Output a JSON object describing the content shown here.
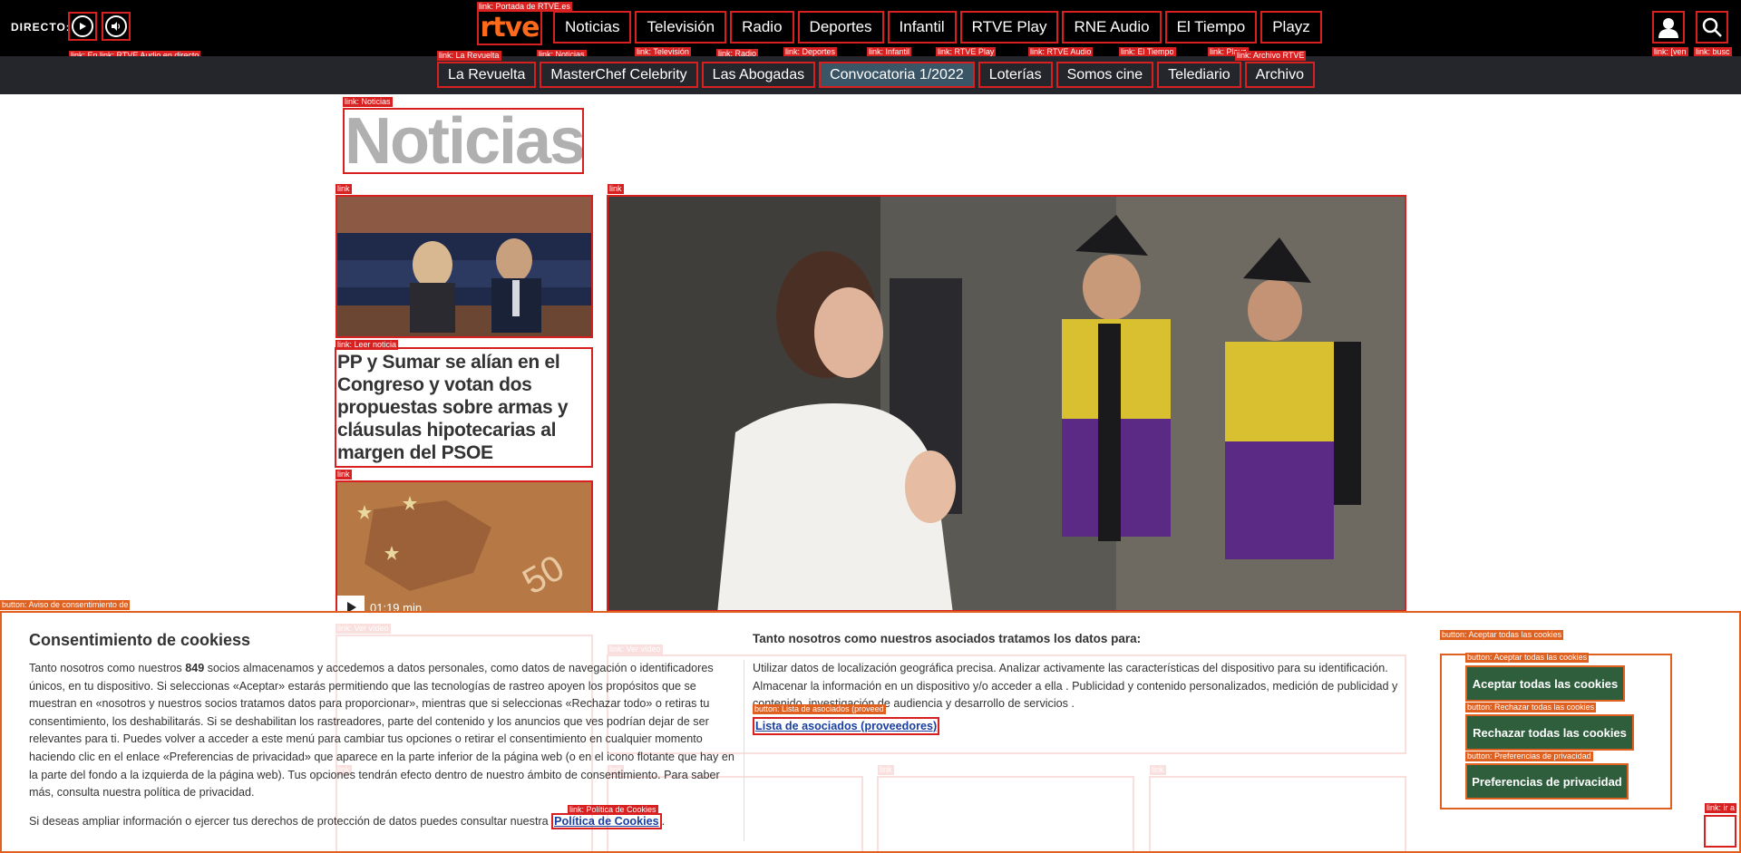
{
  "header": {
    "directo_label": "DIRECTO:",
    "logo_text": "rtve",
    "nav": [
      "Noticias",
      "Televisión",
      "Radio",
      "Deportes",
      "Infantil",
      "RTVE Play",
      "RNE Audio",
      "El Tiempo",
      "Playz"
    ],
    "subnav": [
      "La Revuelta",
      "MasterChef Celebrity",
      "Las Abogadas",
      "Convocatoria 1/2022",
      "Loterías",
      "Somos cine",
      "Telediario",
      "Archivo"
    ],
    "subnav_active": "Convocatoria 1/2022"
  },
  "overlay_tags": {
    "logo": "link: Portada de RTVE.es",
    "live": "link: En link: RTVE Audio en directo",
    "nav_noticias": "link: Noticias",
    "nav_tv": "link: Televisión",
    "nav_radio": "link: Radio",
    "nav_deportes": "link: Deportes",
    "nav_infantil": "link: Infantil",
    "nav_play": "link: RTVE Play",
    "nav_audio": "link: RTVE Audio",
    "nav_tiempo": "link: El Tiempo",
    "nav_playz": "link: Playz",
    "sub_revuelta": "link: La Revuelta",
    "sub_archivo": "link: Archivo RTVE",
    "user": "link: [ven",
    "search": "link: busc",
    "section": "link: Noticias",
    "card1": "link",
    "card1_read": "link: Leer noticia",
    "card2": "link",
    "card2_video": "link: Ver vídeo",
    "hero": "link",
    "hero_video": "link: Ver vídeo",
    "cookie_notice": "button: Aviso de consentimiento de",
    "accept_outer": "button: Aceptar todas las cookies",
    "accept_inner": "button: Aceptar todas las cookies",
    "reject": "button: Rechazar todas las cookies",
    "prefs": "button: Preferencias de privacidad",
    "vendors": "button: Lista de asociados (proveed",
    "cookie_policy": "link: Política de Cookies",
    "up": "link: ir a",
    "row_links": "link"
  },
  "main": {
    "section_title": "Noticias",
    "card1": {
      "headline": "PP y Sumar se alían en el Congreso y votan dos propuestas sobre armas y cláusulas hipotecarias al margen del PSOE"
    },
    "card2": {
      "duration": "01:19 min"
    }
  },
  "cookie_banner": {
    "title": "Consentimiento de cookiess",
    "intro_before": "Tanto nosotros como nuestros ",
    "partner_count": "849",
    "intro_after": " socios almacenamos y accedemos a datos personales, como datos de navegación o identificadores únicos, en tu dispositivo. Si seleccionas «Aceptar» estarás permitiendo que las tecnologías de rastreo apoyen los propósitos que se muestran en «nosotros y nuestros socios tratamos datos para proporcionar», mientras que si seleccionas «Rechazar todo» o retiras tu consentimiento, los deshabilitarás. Si se deshabilitan los rastreadores, parte del contenido y los anuncios que ves podrían dejar de ser relevantes para ti. Puedes volver a acceder a este menú para cambiar tus opciones o retirar el consentimiento en cualquier momento haciendo clic en el enlace «Preferencias de privacidad» que aparece en la parte inferior de la página web (o en el icono flotante que hay en la parte del fondo a la izquierda de la página web). Tus opciones tendrán efecto dentro de nuestro ámbito de consentimiento. Para saber más, consulta nuestra política de privacidad.",
    "more_text": "Si deseas ampliar información o ejercer tus derechos de protección de datos puedes consultar nuestra ",
    "policy_link": "Política de Cookies",
    "purpose_title": "Tanto nosotros como nuestros asociados tratamos los datos para:",
    "purpose_text": "Utilizar datos de localización geográfica precisa. Analizar activamente las características del dispositivo para su identificación. Almacenar la información en un dispositivo y/o acceder a ella . Publicidad y contenido personalizados, medición de publicidad y contenido, investigación de audiencia y desarrollo de servicios .",
    "vendors_link": "Lista de asociados (proveedores)",
    "accept_label": "Aceptar todas las cookies",
    "reject_label": "Rechazar todas las cookies",
    "prefs_label": "Preferencias de privacidad"
  },
  "colors": {
    "accent": "#ff6a1a",
    "button_green": "#2f5e3d",
    "link_blue": "#1a3fa0"
  }
}
